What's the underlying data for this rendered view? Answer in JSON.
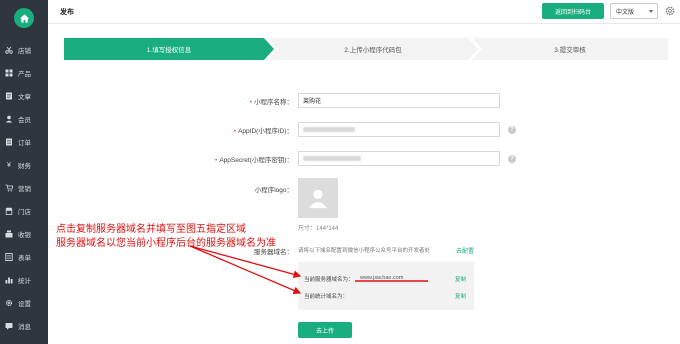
{
  "header": {
    "title": "发布",
    "back_button": "返回到扫码台",
    "language": "中文版"
  },
  "sidebar": {
    "items": [
      {
        "label": "店铺",
        "icon": "scissors-icon"
      },
      {
        "label": "产品",
        "icon": "grid-icon"
      },
      {
        "label": "文章",
        "icon": "document-icon"
      },
      {
        "label": "会员",
        "icon": "user-icon"
      },
      {
        "label": "订单",
        "icon": "list-icon"
      },
      {
        "label": "财务",
        "icon": "yen-icon"
      },
      {
        "label": "营销",
        "icon": "cart-icon"
      },
      {
        "label": "门店",
        "icon": "store-icon"
      },
      {
        "label": "收银",
        "icon": "cashier-icon"
      },
      {
        "label": "表单",
        "icon": "form-icon"
      },
      {
        "label": "统计",
        "icon": "bar-chart-icon"
      },
      {
        "label": "设置",
        "icon": "gear-icon"
      },
      {
        "label": "消息",
        "icon": "message-icon"
      }
    ]
  },
  "steps": [
    "1.填写授权信息",
    "2.上传小程序代码包",
    "3.提交审核"
  ],
  "form": {
    "name_label": "小程序名称：",
    "name_value": "莱购花",
    "appid_label": "AppID(小程序ID)：",
    "secret_label": "AppSecret(小程序密钥)：",
    "logo_label": "小程序logo：",
    "logo_size": "尺寸：144*144",
    "server_label": "服务器域名：",
    "server_hint": "请将以下域名配置到微信小程序公众号平台的开发者处",
    "configure_link": "去配置",
    "server_domain_label": "当前服务器域名为：",
    "server_domain_value": "www.jsw.hao.com",
    "copy1": "复制",
    "stats_domain_label": "当前统计域名为：",
    "copy2": "复制",
    "upload_button": "去上传"
  },
  "annotation": {
    "line1": "点击复制服务器域名并填写至图五指定区域",
    "line2": "服务器域名以您当前小程序后台的服务器域名为准"
  },
  "colors": {
    "accent": "#1aad7d",
    "sidebar": "#2f3640",
    "annotation": "#e01010"
  }
}
